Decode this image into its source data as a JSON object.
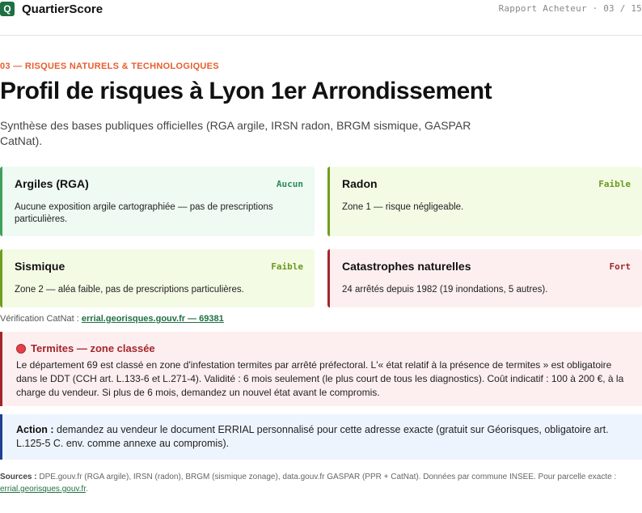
{
  "header": {
    "logo_letter": "Q",
    "brand": "QuartierScore",
    "report_label": "Rapport Acheteur · 03 / 15"
  },
  "section": {
    "label": "03 — RISQUES NATURELS & TECHNOLOGIQUES",
    "title": "Profil de risques à Lyon 1er Arrondissement",
    "subtitle": "Synthèse des bases publiques officielles (RGA argile, IRSN radon, BRGM sismique, GASPAR CatNat)."
  },
  "cards": [
    {
      "title": "Argiles (RGA)",
      "level": "Aucun",
      "level_color": "#2e8b57",
      "description": "Aucune exposition argile cartographiée — pas de prescriptions particulières."
    },
    {
      "title": "Radon",
      "level": "Faible",
      "level_color": "#6a9a1a",
      "description": "Zone 1 — risque négligeable."
    },
    {
      "title": "Sismique",
      "level": "Faible",
      "level_color": "#6a9a1a",
      "description": "Zone 2 — aléa faible, pas de prescriptions particulières."
    },
    {
      "title": "Catastrophes naturelles",
      "level": "Fort",
      "level_color": "#a3262c",
      "description": "24 arrêtés depuis 1982 (19 inondations, 5 autres)."
    }
  ],
  "verification": {
    "label": "Vérification CatNat :",
    "link": "errial.georisques.gouv.fr — 69381"
  },
  "alert": {
    "title": "Termites — zone classée",
    "body": "Le département 69 est classé en zone d'infestation termites par arrêté préfectoral. L'« état relatif à la présence de termites » est obligatoire dans le DDT (CCH art. L.133-6 et L.271-4). Validité : 6 mois seulement (le plus court de tous les diagnostics). Coût indicatif : 100 à 200 €, à la charge du vendeur. Si plus de 6 mois, demandez un nouvel état avant le compromis."
  },
  "action": {
    "label": "Action :",
    "text": "demandez au vendeur le document ERRIAL personnalisé pour cette adresse exacte (gratuit sur Géorisques, obligatoire art. L.125-5 C. env. comme annexe au compromis)."
  },
  "sources": {
    "label": "Sources :",
    "text": "DPE.gouv.fr (RGA argile), IRSN (radon), BRGM (sismique zonage), data.gouv.fr GASPAR (PPR + CatNat). Données par commune INSEE. Pour parcelle exacte :",
    "link": "errial.georisques.gouv.fr",
    "end": "."
  },
  "colors": {
    "brand": "#1f6f43",
    "section_accent": "#e85d2c",
    "alert_red": "#a3262c",
    "action_blue": "#1f3f8f"
  }
}
